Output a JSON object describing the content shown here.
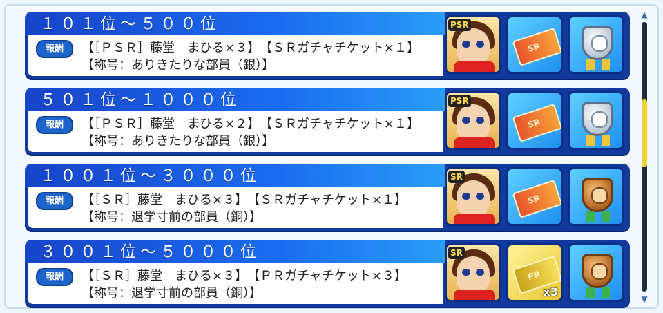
{
  "badge_label": "報酬",
  "rows": [
    {
      "title": "１０１位〜５００位",
      "line1": "【［ＰＳＲ］藤堂　まひる×３】　【ＳＲガチャチケット×１】",
      "line2": "【称号：ありきたりな部員（銀）】",
      "card_rank": "PSR",
      "ticket_type": "SR",
      "ticket_text": "SR",
      "ticket_count": "",
      "medal": "silver"
    },
    {
      "title": "５０１位〜１０００位",
      "line1": "【［ＰＳＲ］藤堂　まひる×２】　【ＳＲガチャチケット×１】",
      "line2": "【称号：ありきたりな部員（銀）】",
      "card_rank": "PSR",
      "ticket_type": "SR",
      "ticket_text": "SR",
      "ticket_count": "",
      "medal": "silver"
    },
    {
      "title": "１００１位〜３０００位",
      "line1": "【［ＳＲ］藤堂　まひる×３】　【ＳＲガチャチケット×１】",
      "line2": "【称号：退学寸前の部員（銅）】",
      "card_rank": "SR",
      "ticket_type": "SR",
      "ticket_text": "SR",
      "ticket_count": "",
      "medal": "bronze"
    },
    {
      "title": "３００１位〜５０００位",
      "line1": "【［ＳＲ］藤堂　まひる×３】　【ＰＲガチャチケット×３】",
      "line2": "【称号：退学寸前の部員（銅）】",
      "card_rank": "SR",
      "ticket_type": "PR",
      "ticket_text": "PR",
      "ticket_count": "x3",
      "medal": "bronze"
    }
  ]
}
